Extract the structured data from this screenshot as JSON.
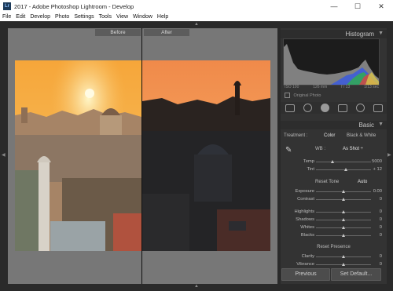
{
  "window": {
    "app_icon": "Lr",
    "title": "2017 - Adobe Photoshop Lightroom - Develop",
    "minimize": "—",
    "maximize": "☐",
    "close": "✕"
  },
  "menu": [
    "File",
    "Edit",
    "Develop",
    "Photo",
    "Settings",
    "Tools",
    "View",
    "Window",
    "Help"
  ],
  "view": {
    "before_label": "Before",
    "after_label": "After"
  },
  "panel": {
    "histogram_title": "Histogram",
    "histogram_values": [
      "ISO 100",
      "126 mm",
      "f / 13",
      "1/13 sec"
    ],
    "original_photo": "Original Photo",
    "basic_title": "Basic",
    "treatment_label": "Treatment :",
    "treatment_color": "Color",
    "treatment_bw": "Black & White",
    "wb_label": "WB :",
    "wb_value": "As Shot ÷",
    "temp_label": "Temp",
    "temp_value": "5000",
    "tint_label": "Tint",
    "tint_value": "+ 12",
    "tone_label": "Reset Tone",
    "tone_auto": "Auto",
    "exposure_label": "Exposure",
    "exposure_value": "0.00",
    "contrast_label": "Contrast",
    "contrast_value": "0",
    "highlights_label": "Highlights",
    "highlights_value": "0",
    "shadows_label": "Shadows",
    "shadows_value": "0",
    "whites_label": "Whites",
    "whites_value": "0",
    "blacks_label": "Blacks",
    "blacks_value": "0",
    "presence_label": "Reset Presence",
    "clarity_label": "Clarity",
    "clarity_value": "0",
    "vibrance_label": "Vibrance",
    "vibrance_value": "0",
    "previous_button": "Previous",
    "set_default_button": "Set Default..."
  },
  "sliders": {
    "temp": 0.3,
    "tint": 0.55,
    "exposure": 0.5,
    "contrast": 0.5,
    "highlights": 0.5,
    "shadows": 0.5,
    "whites": 0.5,
    "blacks": 0.5,
    "clarity": 0.5,
    "vibrance": 0.5
  },
  "icons": {
    "eyedropper": "eyedropper-icon",
    "panel_collapse": "triangle-icon"
  }
}
